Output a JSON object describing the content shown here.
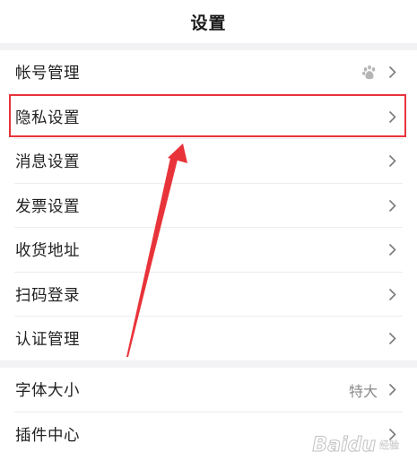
{
  "header": {
    "title": "设置"
  },
  "groups": [
    {
      "items": [
        {
          "label": "帐号管理",
          "icon": "baidu-paw-icon"
        },
        {
          "label": "隐私设置"
        },
        {
          "label": "消息设置"
        },
        {
          "label": "发票设置"
        },
        {
          "label": "收货地址"
        },
        {
          "label": "扫码登录"
        },
        {
          "label": "认证管理"
        }
      ]
    },
    {
      "items": [
        {
          "label": "字体大小",
          "value": "特大"
        },
        {
          "label": "插件中心"
        }
      ]
    }
  ],
  "annotation": {
    "highlight_color": "#e8333a",
    "highlighted_item": "隐私设置"
  },
  "watermark": {
    "text": "Baidu",
    "subtext": "经验"
  }
}
